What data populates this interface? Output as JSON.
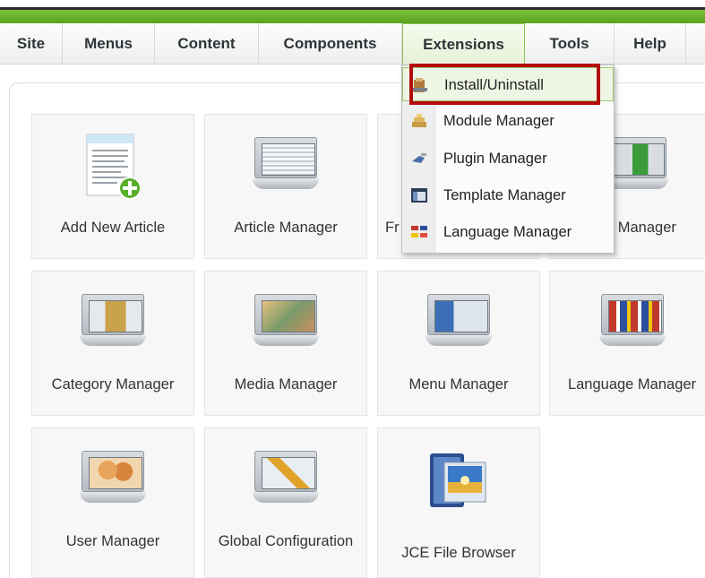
{
  "menubar": {
    "items": [
      {
        "label": "Site"
      },
      {
        "label": "Menus"
      },
      {
        "label": "Content"
      },
      {
        "label": "Components"
      },
      {
        "label": "Extensions"
      },
      {
        "label": "Tools"
      },
      {
        "label": "Help"
      }
    ],
    "active": "Extensions"
  },
  "extensions_menu": {
    "items": [
      {
        "label": "Install/Uninstall",
        "icon": "install-box-icon"
      },
      {
        "label": "Module Manager",
        "icon": "module-blocks-icon"
      },
      {
        "label": "Plugin Manager",
        "icon": "plugin-plug-icon"
      },
      {
        "label": "Template Manager",
        "icon": "template-window-icon"
      },
      {
        "label": "Language Manager",
        "icon": "language-flags-icon"
      }
    ],
    "highlighted": "Install/Uninstall"
  },
  "tiles": {
    "add_article": "Add New Article",
    "article_manager": "Article Manager",
    "frontpage_partial": "Fr",
    "section_partial": "n Manager",
    "category_manager": "Category Manager",
    "media_manager": "Media Manager",
    "menu_manager": "Menu Manager",
    "language_manager": "Language Manager",
    "user_manager": "User Manager",
    "global_config": "Global Configuration",
    "jce_browser": "JCE File Browser"
  },
  "colors": {
    "accent_green": "#6fb52c",
    "highlight_red": "#b30d0d"
  }
}
